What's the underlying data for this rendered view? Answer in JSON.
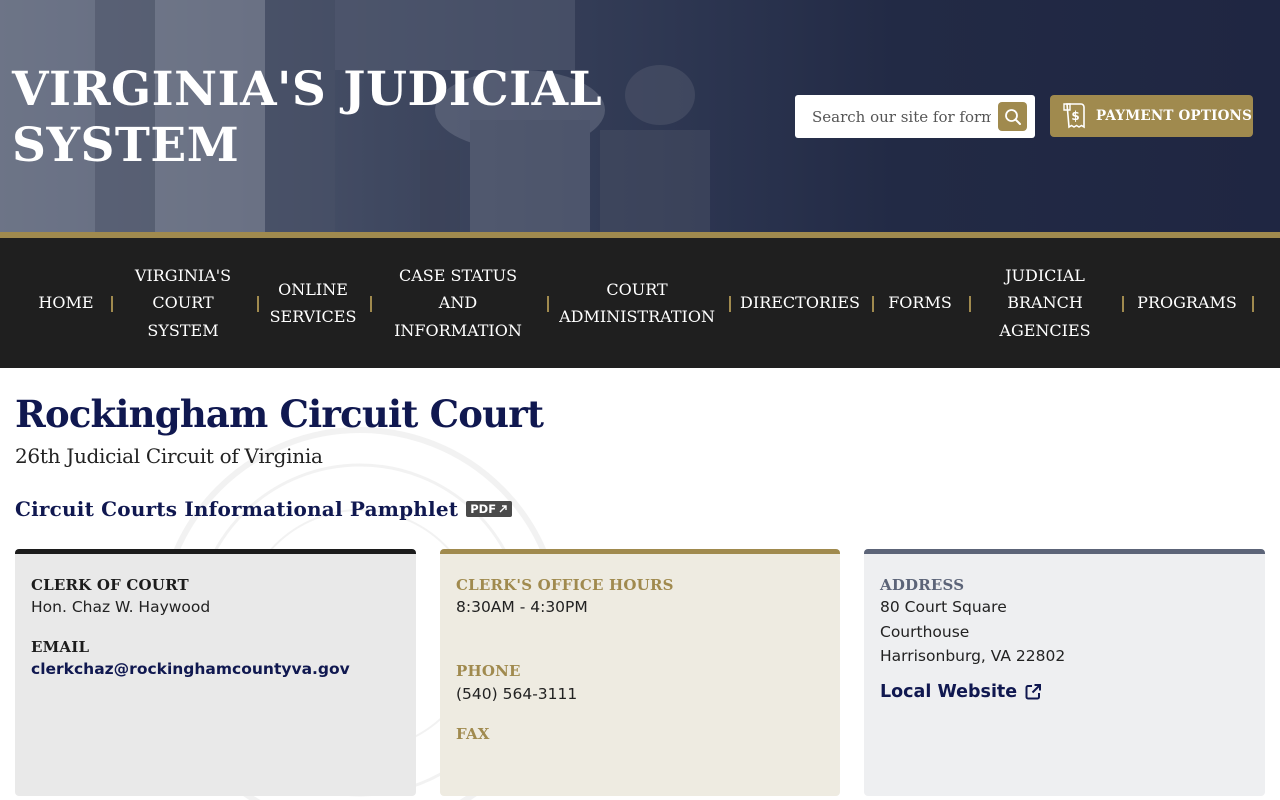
{
  "header": {
    "site_title": "VIRGINIA'S JUDICIAL SYSTEM",
    "search": {
      "placeholder": "Search our site for forms,",
      "icon": "search-icon"
    },
    "payment_button": {
      "label": "PAYMENT OPTIONS",
      "icon": "payment-receipt-icon"
    }
  },
  "nav": {
    "items": [
      {
        "label_lines": [
          "HOME"
        ]
      },
      {
        "label_lines": [
          "VIRGINIA'S",
          "COURT",
          "SYSTEM"
        ]
      },
      {
        "label_lines": [
          "ONLINE",
          "SERVICES"
        ]
      },
      {
        "label_lines": [
          "CASE STATUS",
          "AND",
          "INFORMATION"
        ]
      },
      {
        "label_lines": [
          "COURT",
          "ADMINISTRATION"
        ]
      },
      {
        "label_lines": [
          "DIRECTORIES"
        ]
      },
      {
        "label_lines": [
          "FORMS"
        ]
      },
      {
        "label_lines": [
          "JUDICIAL",
          "BRANCH",
          "AGENCIES"
        ]
      },
      {
        "label_lines": [
          "PROGRAMS"
        ]
      }
    ]
  },
  "main": {
    "title": "Rockingham Circuit Court",
    "subtitle": "26th Judicial Circuit of Virginia",
    "pamphlet": {
      "label": "Circuit Courts Informational Pamphlet",
      "badge": "PDF",
      "badge_icon": "external-arrow-icon"
    }
  },
  "cards": {
    "clerk": {
      "clerk_label": "CLERK OF COURT",
      "clerk_name": "Hon. Chaz W. Haywood",
      "email_label": "EMAIL",
      "email": "clerkchaz@rockinghamcountyva.gov"
    },
    "hours": {
      "hours_label": "CLERK'S OFFICE HOURS",
      "hours": "8:30AM - 4:30PM",
      "phone_label": "PHONE",
      "phone": "(540) 564-3111",
      "fax_label": "FAX"
    },
    "address": {
      "address_label": "ADDRESS",
      "line1": "80 Court Square",
      "line2": "Courthouse",
      "line3": "Harrisonburg, VA 22802",
      "website_label": "Local Website",
      "website_icon": "external-link-icon"
    }
  },
  "colors": {
    "navy": "#101850",
    "gold": "#a08a4e",
    "nav_bg": "#1f1f1f",
    "header_dark": "#1f2642"
  }
}
